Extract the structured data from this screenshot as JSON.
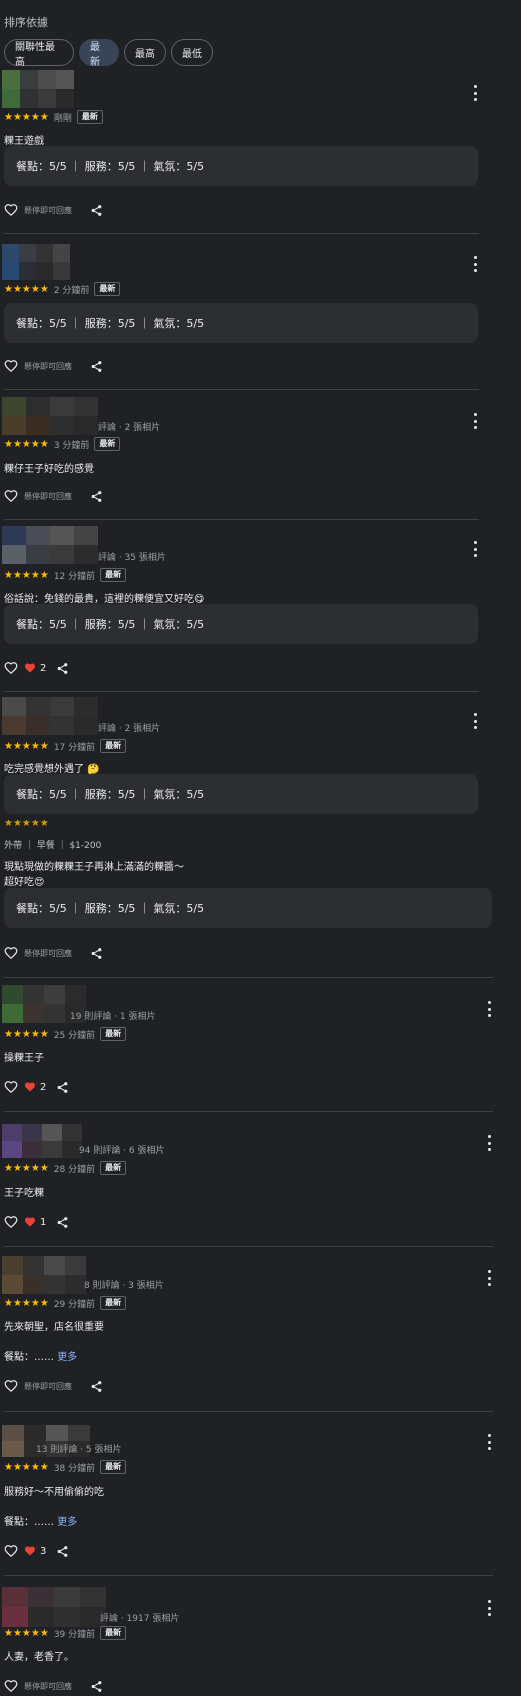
{
  "sort": {
    "label": "排序依據",
    "chips": [
      "關聯性最高",
      "最新",
      "最高",
      "最低"
    ]
  },
  "labels": {
    "hover_reply": "懸停即可回應",
    "newest_badge": "最新",
    "more": "更多"
  },
  "reviews": [
    {
      "stars": "★★★★★",
      "time": "剛剛",
      "text": "粿王遊戲",
      "details": "餐點：5/5 ｜ 服務：5/5 ｜ 氣氛：5/5"
    },
    {
      "stars": "★★★★★",
      "time": "2 分鐘前",
      "details": "餐點：5/5 ｜ 服務：5/5 ｜ 氣氛：5/5"
    },
    {
      "stars": "★★★★★",
      "meta": "評論 · 2 張相片",
      "time": "3 分鐘前",
      "text": "粿仔王子好吃的感覺"
    },
    {
      "stars": "★★★★★",
      "meta": "評論 · 35 張相片",
      "time": "12 分鐘前",
      "text": "俗話說：免錢的最貴，這裡的粿便宜又好吃😋",
      "details": "餐點：5/5 ｜ 服務：5/5 ｜ 氣氛：5/5",
      "likes": "2"
    },
    {
      "stars": "★★★★★",
      "meta": "評論 · 2 張相片",
      "time": "17 分鐘前",
      "text": "吃完感覺想外遇了 🤔",
      "details": "餐點：5/5 ｜ 服務：5/5 ｜ 氣氛：5/5"
    },
    {
      "tags": "外帶 ｜ 早餐 ｜ $1-200",
      "text": "現點現做的粿粿王子再淋上滿滿的粿醬～",
      "text2": "超好吃😍",
      "details": "餐點：5/5 ｜ 服務：5/5 ｜ 氣氛：5/5"
    },
    {
      "stars": "★★★★★",
      "meta": "19 則評論 · 1 張相片",
      "time": "25 分鐘前",
      "text": "操粿王子",
      "likes": "2"
    },
    {
      "stars": "★★★★★",
      "meta": "94 則評論 · 6 張相片",
      "time": "28 分鐘前",
      "text": "王子吃粿",
      "likes": "1"
    },
    {
      "stars": "★★★★★",
      "meta": "8 則評論 · 3 張相片",
      "time": "29 分鐘前",
      "text": "先來朝聖，店名很重要",
      "text2": "餐點：……"
    },
    {
      "stars": "★★★★★",
      "meta": "13 則評論 · 5 張相片",
      "time": "38 分鐘前",
      "text": "服務好～不用偷偷的吃",
      "text2": "餐點：……",
      "likes": "3"
    },
    {
      "stars": "★★★★★",
      "meta": "評論 · 1917 張相片",
      "time": "39 分鐘前",
      "text": "人妻，老香了。"
    }
  ],
  "colors": {
    "background": "#202124",
    "star": "#fbbc04",
    "link": "#8ab4f8",
    "heart": "#ea4335",
    "active_chip": "#394457"
  }
}
